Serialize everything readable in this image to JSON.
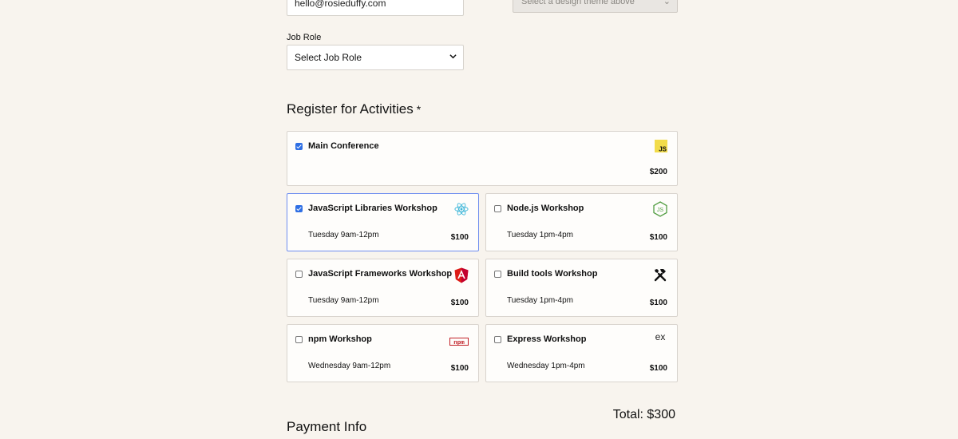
{
  "basic_info": {
    "email_value": "hello@rosieduffy.com",
    "color_placeholder": "Select a design theme above",
    "job_role_label": "Job Role",
    "job_role_value": "Select Job Role"
  },
  "activities": {
    "title": "Register for Activities",
    "required_mark": "*",
    "main": {
      "name": "Main Conference",
      "cost": "$200",
      "checked": true,
      "icon": "javascript-icon"
    },
    "workshops": [
      {
        "name": "JavaScript Libraries Workshop",
        "time": "Tuesday 9am-12pm",
        "cost": "$100",
        "checked": true,
        "icon": "react-icon"
      },
      {
        "name": "Node.js Workshop",
        "time": "Tuesday 1pm-4pm",
        "cost": "$100",
        "checked": false,
        "icon": "nodejs-icon"
      },
      {
        "name": "JavaScript Frameworks Workshop",
        "time": "Tuesday 9am-12pm",
        "cost": "$100",
        "checked": false,
        "icon": "angular-icon"
      },
      {
        "name": "Build tools Workshop",
        "time": "Tuesday 1pm-4pm",
        "cost": "$100",
        "checked": false,
        "icon": "tools-icon"
      },
      {
        "name": "npm Workshop",
        "time": "Wednesday 9am-12pm",
        "cost": "$100",
        "checked": false,
        "icon": "npm-icon"
      },
      {
        "name": "Express Workshop",
        "time": "Wednesday 1pm-4pm",
        "cost": "$100",
        "checked": false,
        "icon": "express-icon"
      }
    ],
    "total": "Total: $300"
  },
  "payment": {
    "title": "Payment Info"
  },
  "colors": {
    "background": "#f8f4ee",
    "selected_border": "#6f8ef0",
    "checkbox_checked": "#2f6fe4"
  }
}
